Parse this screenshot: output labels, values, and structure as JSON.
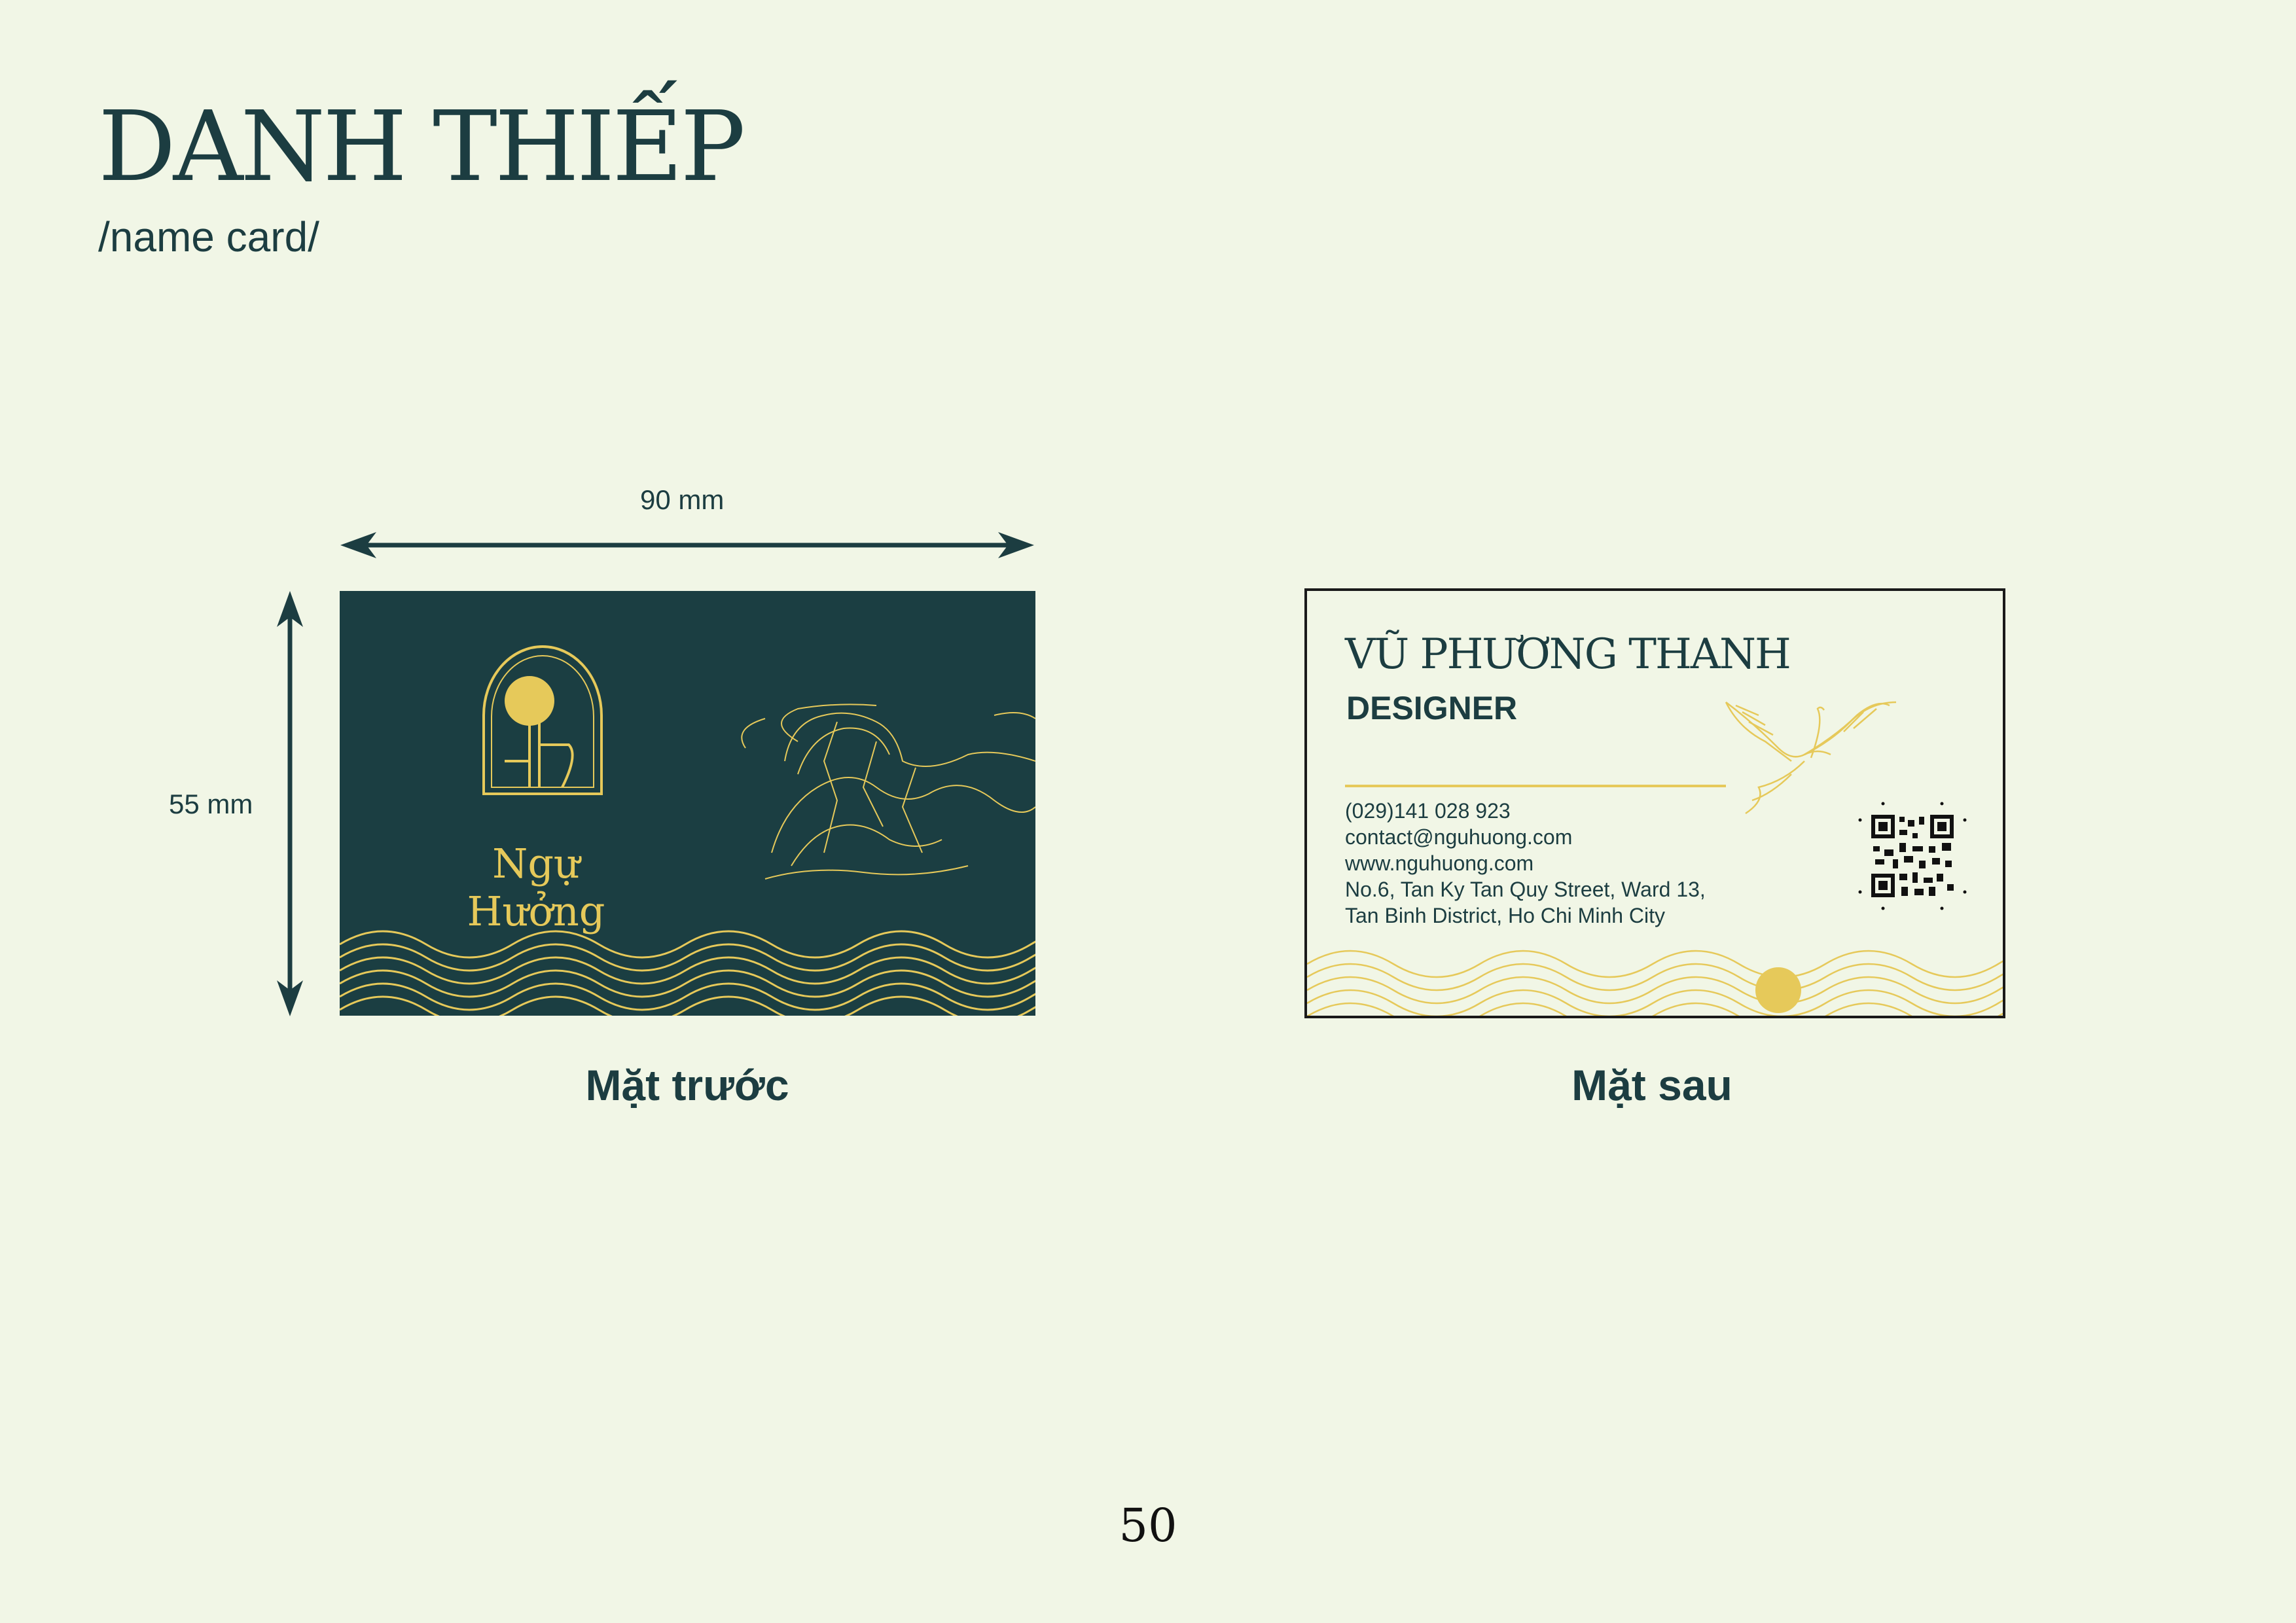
{
  "page": {
    "title": "DANH THIẾP",
    "subtitle": "/name card/",
    "page_number": "50"
  },
  "dimensions": {
    "width_label": "90 mm",
    "height_label": "55 mm"
  },
  "front": {
    "brand_name": "Ngự Hưởng",
    "caption": "Mặt trước"
  },
  "back": {
    "name": "VŨ PHƯƠNG THANH",
    "role": "DESIGNER",
    "phone": "(029)141 028 923",
    "email": "contact@nguhuong.com",
    "website": "www.nguhuong.com",
    "address_line1": "No.6, Tan Ky Tan Quy Street, Ward 13,",
    "address_line2": "Tan Binh District, Ho Chi Minh City",
    "caption": "Mặt sau"
  },
  "colors": {
    "background": "#f1f6e6",
    "dark_green": "#1b3e42",
    "gold": "#e6c95a"
  }
}
